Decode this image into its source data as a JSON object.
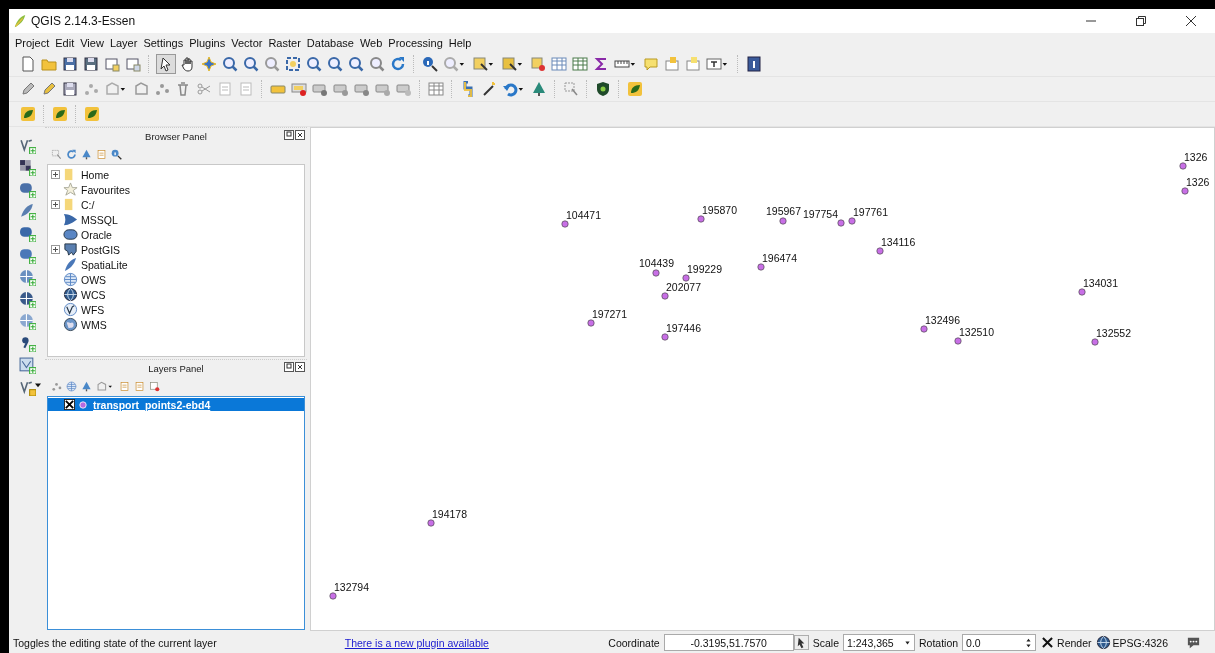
{
  "window": {
    "title": "QGIS 2.14.3-Essen"
  },
  "menu": [
    "Project",
    "Edit",
    "View",
    "Layer",
    "Settings",
    "Plugins",
    "Vector",
    "Raster",
    "Database",
    "Web",
    "Processing",
    "Help"
  ],
  "browser_panel": {
    "title": "Browser Panel",
    "items": [
      {
        "label": "Home",
        "expandable": true
      },
      {
        "label": "Favourites",
        "expandable": false
      },
      {
        "label": "C:/",
        "expandable": true
      },
      {
        "label": "MSSQL",
        "expandable": false
      },
      {
        "label": "Oracle",
        "expandable": false
      },
      {
        "label": "PostGIS",
        "expandable": true
      },
      {
        "label": "SpatiaLite",
        "expandable": false
      },
      {
        "label": "OWS",
        "expandable": false
      },
      {
        "label": "WCS",
        "expandable": false
      },
      {
        "label": "WFS",
        "expandable": false
      },
      {
        "label": "WMS",
        "expandable": false
      }
    ]
  },
  "layers_panel": {
    "title": "Layers Panel",
    "layers": [
      {
        "name": "transport_points2-ebd4",
        "checked": true,
        "selected": true
      }
    ]
  },
  "map": {
    "points": [
      {
        "label": "1326"
      },
      {
        "label": "1326"
      },
      {
        "label": "104471"
      },
      {
        "label": "195870"
      },
      {
        "label": "195967"
      },
      {
        "label": "197754"
      },
      {
        "label": "197761"
      },
      {
        "label": "134116"
      },
      {
        "label": "104439"
      },
      {
        "label": "199229"
      },
      {
        "label": "202077"
      },
      {
        "label": "196474"
      },
      {
        "label": "197271"
      },
      {
        "label": "197446"
      },
      {
        "label": "132496"
      },
      {
        "label": "132510"
      },
      {
        "label": "134031"
      },
      {
        "label": "132552"
      },
      {
        "label": "194178"
      },
      {
        "label": "132794"
      }
    ]
  },
  "status_bar": {
    "message": "Toggles the editing state of the current layer",
    "plugin_link": "There is a new plugin available",
    "coordinate_label": "Coordinate",
    "coordinate": "-0.3195,51.7570",
    "scale_label": "Scale",
    "scale": "1:243,365",
    "rotation_label": "Rotation",
    "rotation": "0.0",
    "render_label": "Render",
    "render_checked": true,
    "crs": "EPSG:4326"
  }
}
